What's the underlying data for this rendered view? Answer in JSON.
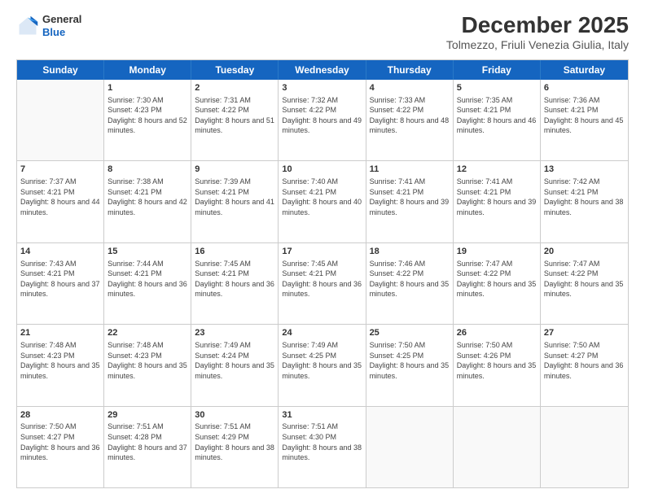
{
  "logo": {
    "general": "General",
    "blue": "Blue"
  },
  "title": "December 2025",
  "subtitle": "Tolmezzo, Friuli Venezia Giulia, Italy",
  "days": [
    "Sunday",
    "Monday",
    "Tuesday",
    "Wednesday",
    "Thursday",
    "Friday",
    "Saturday"
  ],
  "rows": [
    [
      {
        "num": "",
        "sunrise": "",
        "sunset": "",
        "daylight": ""
      },
      {
        "num": "1",
        "sunrise": "7:30 AM",
        "sunset": "4:23 PM",
        "daylight": "8 hours and 52 minutes."
      },
      {
        "num": "2",
        "sunrise": "7:31 AM",
        "sunset": "4:22 PM",
        "daylight": "8 hours and 51 minutes."
      },
      {
        "num": "3",
        "sunrise": "7:32 AM",
        "sunset": "4:22 PM",
        "daylight": "8 hours and 49 minutes."
      },
      {
        "num": "4",
        "sunrise": "7:33 AM",
        "sunset": "4:22 PM",
        "daylight": "8 hours and 48 minutes."
      },
      {
        "num": "5",
        "sunrise": "7:35 AM",
        "sunset": "4:21 PM",
        "daylight": "8 hours and 46 minutes."
      },
      {
        "num": "6",
        "sunrise": "7:36 AM",
        "sunset": "4:21 PM",
        "daylight": "8 hours and 45 minutes."
      }
    ],
    [
      {
        "num": "7",
        "sunrise": "7:37 AM",
        "sunset": "4:21 PM",
        "daylight": "8 hours and 44 minutes."
      },
      {
        "num": "8",
        "sunrise": "7:38 AM",
        "sunset": "4:21 PM",
        "daylight": "8 hours and 42 minutes."
      },
      {
        "num": "9",
        "sunrise": "7:39 AM",
        "sunset": "4:21 PM",
        "daylight": "8 hours and 41 minutes."
      },
      {
        "num": "10",
        "sunrise": "7:40 AM",
        "sunset": "4:21 PM",
        "daylight": "8 hours and 40 minutes."
      },
      {
        "num": "11",
        "sunrise": "7:41 AM",
        "sunset": "4:21 PM",
        "daylight": "8 hours and 39 minutes."
      },
      {
        "num": "12",
        "sunrise": "7:41 AM",
        "sunset": "4:21 PM",
        "daylight": "8 hours and 39 minutes."
      },
      {
        "num": "13",
        "sunrise": "7:42 AM",
        "sunset": "4:21 PM",
        "daylight": "8 hours and 38 minutes."
      }
    ],
    [
      {
        "num": "14",
        "sunrise": "7:43 AM",
        "sunset": "4:21 PM",
        "daylight": "8 hours and 37 minutes."
      },
      {
        "num": "15",
        "sunrise": "7:44 AM",
        "sunset": "4:21 PM",
        "daylight": "8 hours and 36 minutes."
      },
      {
        "num": "16",
        "sunrise": "7:45 AM",
        "sunset": "4:21 PM",
        "daylight": "8 hours and 36 minutes."
      },
      {
        "num": "17",
        "sunrise": "7:45 AM",
        "sunset": "4:21 PM",
        "daylight": "8 hours and 36 minutes."
      },
      {
        "num": "18",
        "sunrise": "7:46 AM",
        "sunset": "4:22 PM",
        "daylight": "8 hours and 35 minutes."
      },
      {
        "num": "19",
        "sunrise": "7:47 AM",
        "sunset": "4:22 PM",
        "daylight": "8 hours and 35 minutes."
      },
      {
        "num": "20",
        "sunrise": "7:47 AM",
        "sunset": "4:22 PM",
        "daylight": "8 hours and 35 minutes."
      }
    ],
    [
      {
        "num": "21",
        "sunrise": "7:48 AM",
        "sunset": "4:23 PM",
        "daylight": "8 hours and 35 minutes."
      },
      {
        "num": "22",
        "sunrise": "7:48 AM",
        "sunset": "4:23 PM",
        "daylight": "8 hours and 35 minutes."
      },
      {
        "num": "23",
        "sunrise": "7:49 AM",
        "sunset": "4:24 PM",
        "daylight": "8 hours and 35 minutes."
      },
      {
        "num": "24",
        "sunrise": "7:49 AM",
        "sunset": "4:25 PM",
        "daylight": "8 hours and 35 minutes."
      },
      {
        "num": "25",
        "sunrise": "7:50 AM",
        "sunset": "4:25 PM",
        "daylight": "8 hours and 35 minutes."
      },
      {
        "num": "26",
        "sunrise": "7:50 AM",
        "sunset": "4:26 PM",
        "daylight": "8 hours and 35 minutes."
      },
      {
        "num": "27",
        "sunrise": "7:50 AM",
        "sunset": "4:27 PM",
        "daylight": "8 hours and 36 minutes."
      }
    ],
    [
      {
        "num": "28",
        "sunrise": "7:50 AM",
        "sunset": "4:27 PM",
        "daylight": "8 hours and 36 minutes."
      },
      {
        "num": "29",
        "sunrise": "7:51 AM",
        "sunset": "4:28 PM",
        "daylight": "8 hours and 37 minutes."
      },
      {
        "num": "30",
        "sunrise": "7:51 AM",
        "sunset": "4:29 PM",
        "daylight": "8 hours and 38 minutes."
      },
      {
        "num": "31",
        "sunrise": "7:51 AM",
        "sunset": "4:30 PM",
        "daylight": "8 hours and 38 minutes."
      },
      {
        "num": "",
        "sunrise": "",
        "sunset": "",
        "daylight": ""
      },
      {
        "num": "",
        "sunrise": "",
        "sunset": "",
        "daylight": ""
      },
      {
        "num": "",
        "sunrise": "",
        "sunset": "",
        "daylight": ""
      }
    ]
  ]
}
